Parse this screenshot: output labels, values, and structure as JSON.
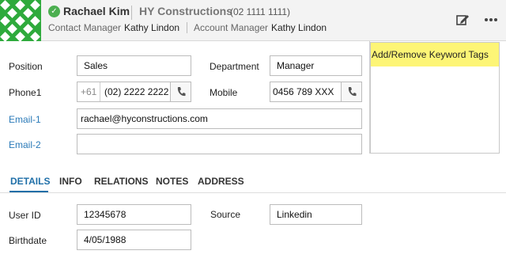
{
  "header": {
    "name": "Rachael Kim",
    "company": "HY Constructions",
    "company_phone": "(02 1111 1111)",
    "contact_manager_label": "Contact Manager",
    "contact_manager_value": "Kathy Lindon",
    "account_manager_label": "Account Manager",
    "account_manager_value": "Kathy Lindon",
    "status_icon": "check-circle-icon",
    "edit_icon": "edit-icon",
    "more_icon": "more-options-icon"
  },
  "form": {
    "position_label": "Position",
    "position_value": "Sales",
    "department_label": "Department",
    "department_value": "Manager",
    "phone1_label": "Phone1",
    "phone1_prefix": "+61",
    "phone1_value": "(02) 2222 2222",
    "mobile_label": "Mobile",
    "mobile_value": "0456 789 XXX",
    "email1_label": "Email-1",
    "email1_value": "rachael@hyconstructions.com",
    "email2_label": "Email-2",
    "email2_value": ""
  },
  "tags": {
    "button_label": "Add/Remove Keyword Tags"
  },
  "tabs": [
    {
      "label": "DETAILS",
      "active": true
    },
    {
      "label": "INFO",
      "active": false
    },
    {
      "label": "RELATIONS",
      "active": false
    },
    {
      "label": "NOTES",
      "active": false
    },
    {
      "label": "ADDRESS",
      "active": false
    }
  ],
  "details": {
    "user_id_label": "User ID",
    "user_id_value": "12345678",
    "source_label": "Source",
    "source_value": "Linkedin",
    "birthdate_label": "Birthdate",
    "birthdate_value": "4/05/1988"
  },
  "colors": {
    "accent": "#1f6fa8",
    "link": "#2a7ab8",
    "tag_button": "#fdf576",
    "avatar_green": "#2eaa3c",
    "status_green": "#4caf50"
  }
}
